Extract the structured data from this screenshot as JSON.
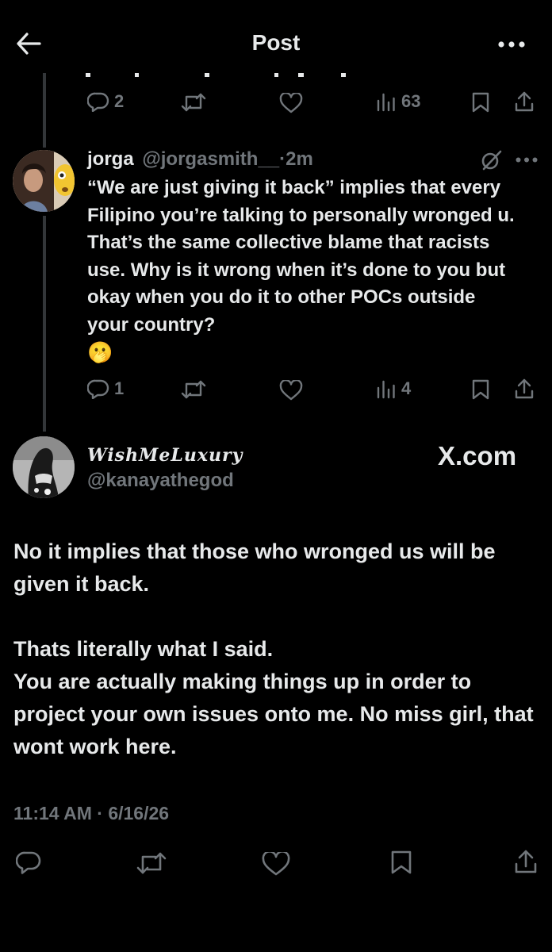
{
  "header": {
    "title": "Post"
  },
  "parent_actions": {
    "reply_count": "2",
    "views_count": "63"
  },
  "reply": {
    "display_name": "jorga",
    "handle": "@jorgasmith__",
    "separator": "·",
    "time": "2m",
    "text": "“We are just giving it back” implies that every Filipino you’re talking to personally wronged u. That’s the same collective blame that racists use. Why is it wrong when it’s done to you but okay when you do it to other POCs outside your country?",
    "emoji": "🫢",
    "reply_count": "1",
    "views_count": "4"
  },
  "main_post": {
    "display_name": "WishMeLuxury",
    "handle": "@kanayathegod",
    "watermark": "X.com",
    "paragraph1": "No it implies that those who wronged us will be given it back.",
    "paragraph2_line1": "Thats literally what I said.",
    "paragraph2_line2": "You are actually making things up in order to project your own issues onto me. No miss girl, that wont work here.",
    "time": "11:14 AM",
    "separator": "·",
    "date": "6/16/26"
  },
  "colors": {
    "background": "#000000",
    "text": "#e7e9ea",
    "muted": "#71767b",
    "thread_line": "#333639"
  }
}
